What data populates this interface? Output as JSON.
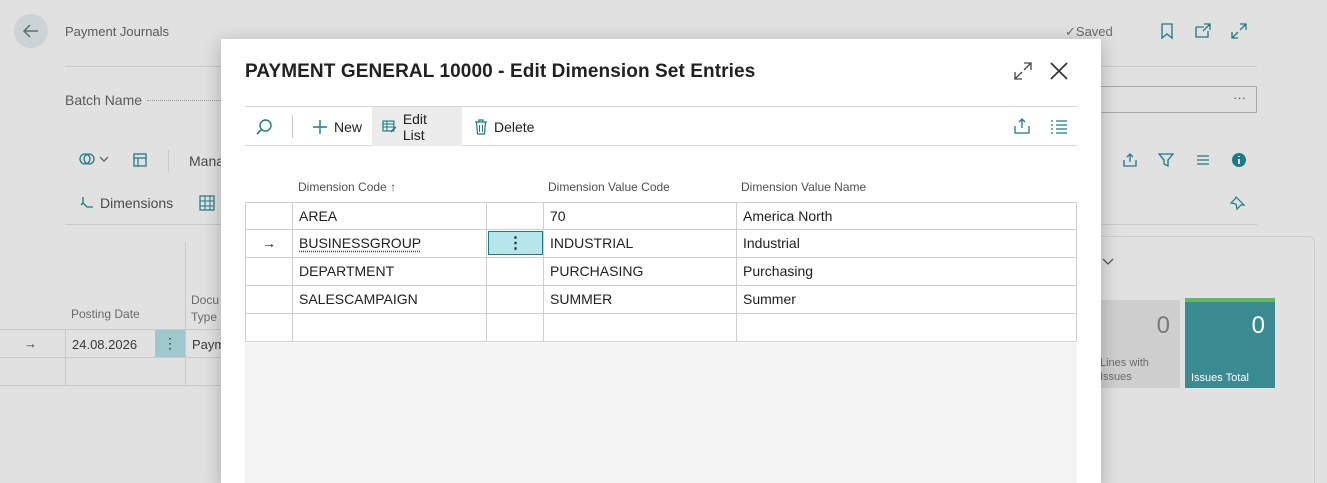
{
  "background": {
    "page_title": "Payment Journals",
    "saved_text": "Saved",
    "batch_label": "Batch Name",
    "batch_field_ellipsis": "···",
    "toolbar_manage": "Mana",
    "toolbar_dimensions": "Dimensions",
    "col_posting_date": "Posting Date",
    "col_document_type_1": "Docu",
    "col_document_type_2": "Type",
    "row_posting_date": "24.08.2026",
    "row_doc_type": "Paym",
    "card_lines_issues_value": "0",
    "card_lines_issues_label_1": "Lines with",
    "card_lines_issues_label_2": "Issues",
    "card_issues_total_value": "0",
    "card_issues_total_label": "Issues Total"
  },
  "modal": {
    "title": "PAYMENT GENERAL 10000 - Edit Dimension Set Entries",
    "toolbar": {
      "new_label": "New",
      "edit_list_label": "Edit List",
      "delete_label": "Delete"
    },
    "columns": {
      "dimension_code": "Dimension Code",
      "sort_indicator": "↑",
      "dimension_value_code": "Dimension Value Code",
      "dimension_value_name": "Dimension Value Name"
    },
    "rows": [
      {
        "dimension_code": "AREA",
        "dimension_value_code": "70",
        "dimension_value_name": "America North",
        "selected": false
      },
      {
        "dimension_code": "BUSINESSGROUP",
        "dimension_value_code": "INDUSTRIAL",
        "dimension_value_name": "Industrial",
        "selected": true
      },
      {
        "dimension_code": "DEPARTMENT",
        "dimension_value_code": "PURCHASING",
        "dimension_value_name": "Purchasing",
        "selected": false
      },
      {
        "dimension_code": "SALESCAMPAIGN",
        "dimension_value_code": "SUMMER",
        "dimension_value_name": "Summer",
        "selected": false
      },
      {
        "dimension_code": "",
        "dimension_value_code": "",
        "dimension_value_name": "",
        "selected": false
      }
    ],
    "row_arrow": "→",
    "row_actions_glyph": "⋮"
  },
  "colors": {
    "accent": "#1c7b84",
    "selection_fill": "#b6e6ea",
    "issues_tile": "#3a8a92",
    "issues_tile_top": "#5fb865"
  },
  "icons": [
    "back-arrow-icon",
    "checkmark-icon",
    "bookmark-icon",
    "share-icon",
    "expand-icon",
    "close-icon",
    "search-icon",
    "plus-icon",
    "edit-list-icon",
    "trash-icon",
    "filter-icon",
    "list-icon",
    "info-icon",
    "pin-icon"
  ]
}
